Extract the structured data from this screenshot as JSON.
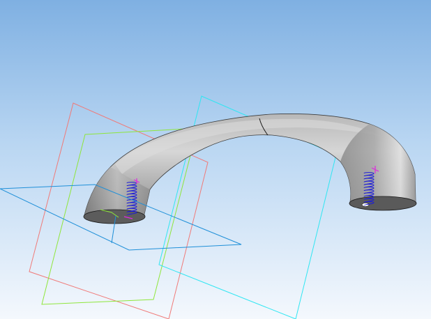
{
  "viewport": {
    "background_top": "#7fb0e2",
    "background_mid": "#b9d6f2",
    "background_bottom": "#f4f8fd"
  },
  "colors": {
    "plane_red": "#f07a78",
    "plane_green": "#8ee63a",
    "plane_cyan": "#2fe6f2",
    "plane_blue": "#1e8fd8",
    "spring": "#1c1cd8",
    "marker": "#e028e0",
    "body_light": "#d0d0d0",
    "body_mid": "#9c9c9c",
    "body_dark": "#5a5a5a",
    "edge": "#1a1a1a",
    "origin_axis": "#8ee63a"
  },
  "objects": {
    "body": "bent-tube",
    "springs": [
      "left-spring",
      "right-spring"
    ],
    "planes": [
      "red-plane",
      "green-plane",
      "cyan-plane",
      "blue-plane"
    ]
  }
}
